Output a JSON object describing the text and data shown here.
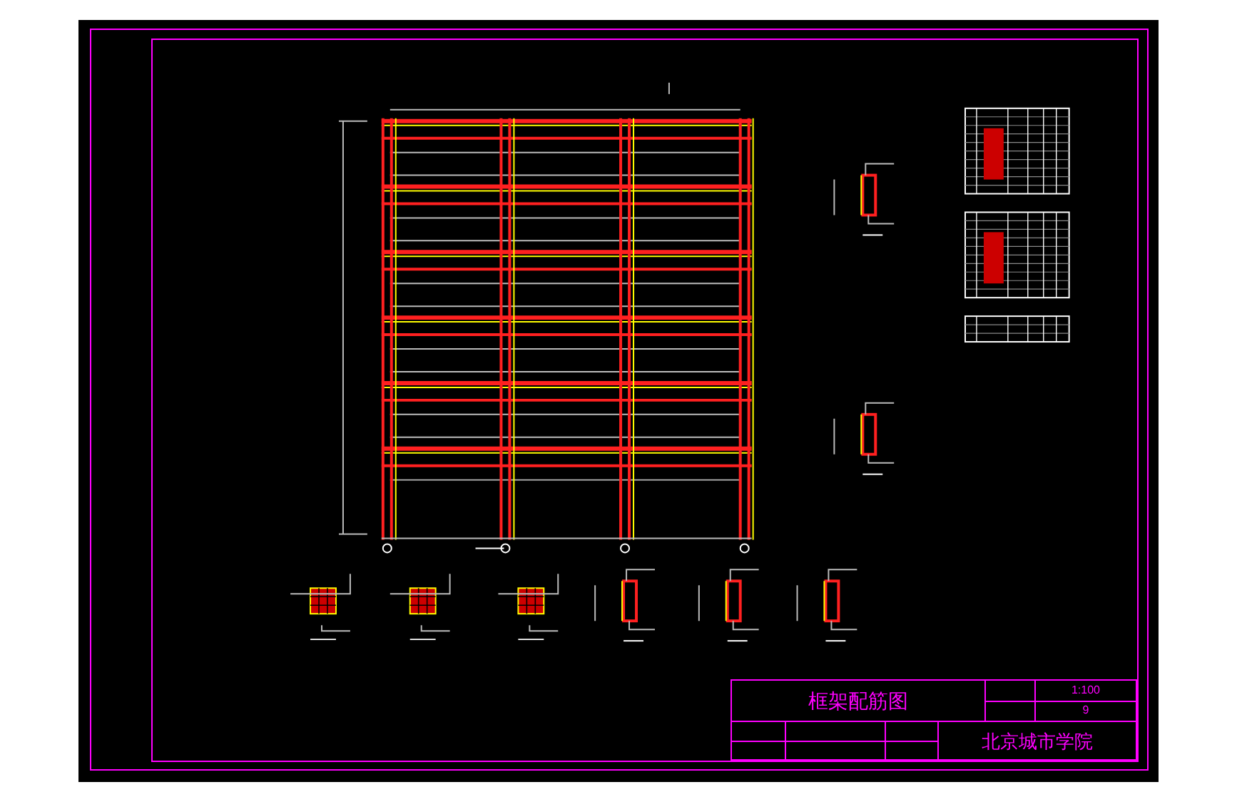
{
  "title_block": {
    "drawing_title": "框架配筋图",
    "scale": "1:100",
    "sheet": "9",
    "school": "北京城市学院"
  }
}
